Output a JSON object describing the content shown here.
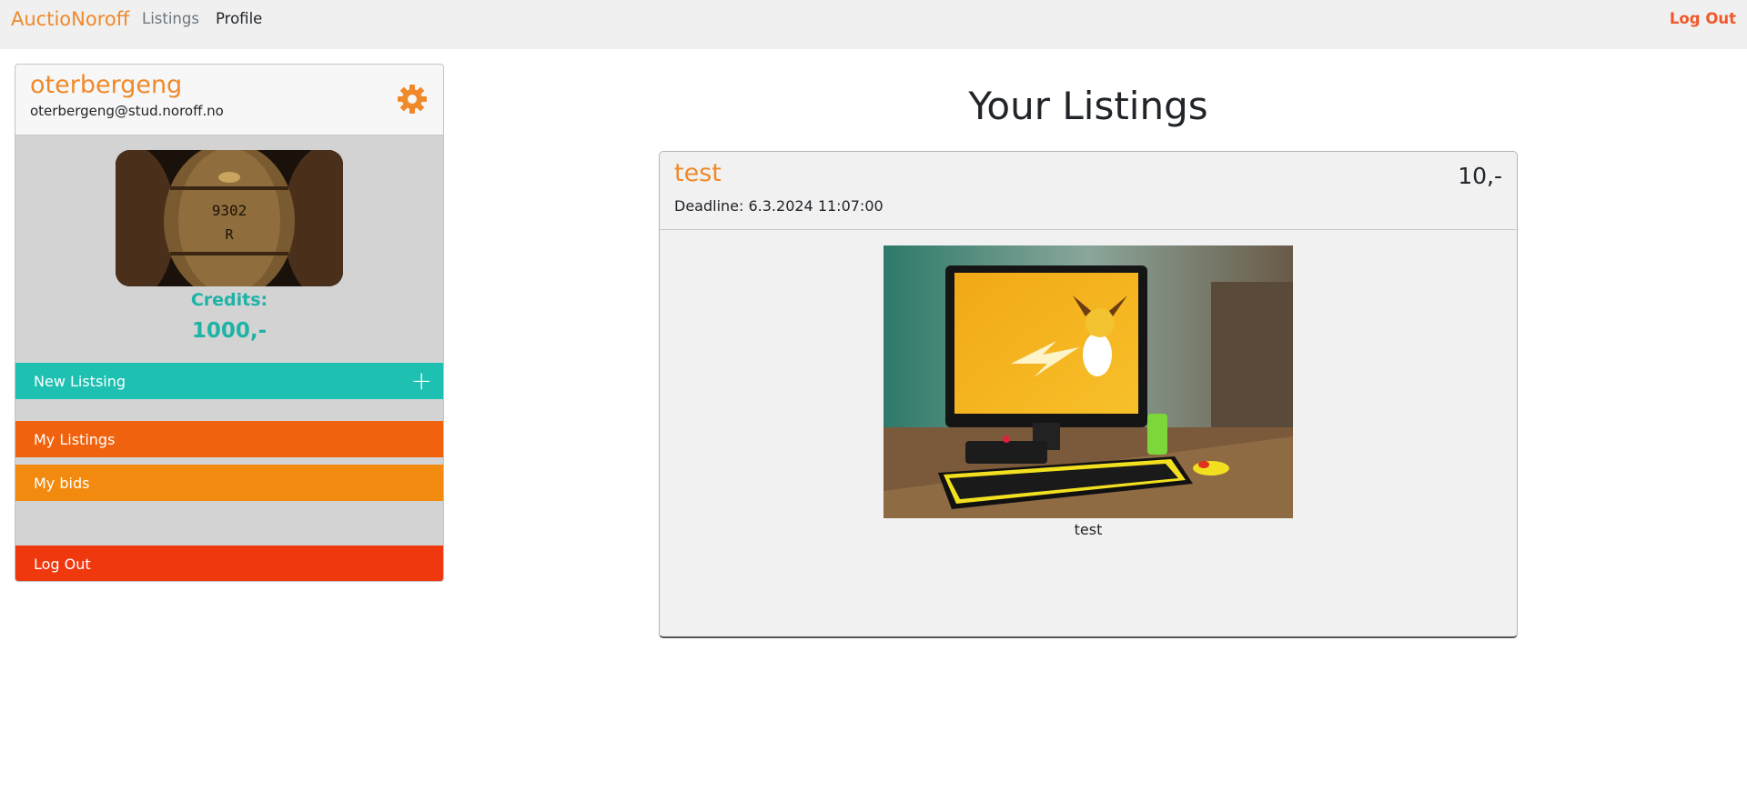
{
  "nav": {
    "brand": "AuctioNoroff",
    "links": [
      "Listings",
      "Profile"
    ],
    "logout": "Log Out"
  },
  "profile": {
    "username": "oterbergeng",
    "email": "oterbergeng@stud.noroff.no",
    "settings_icon": "gear-icon",
    "credits_label": "Credits:",
    "credits_value": "1000,-",
    "buttons": {
      "new_listing": "New Listsing",
      "new_listing_icon": "plus-icon",
      "my_listings": "My Listings",
      "my_bids": "My bids",
      "logout": "Log Out"
    }
  },
  "main": {
    "title": "Your Listings",
    "listings": [
      {
        "title": "test",
        "price": "10,-",
        "deadline": "Deadline: 6.3.2024 11:07:00",
        "caption": "test"
      }
    ]
  },
  "colors": {
    "accent_orange": "#f0892a",
    "teal": "#1ec0b1",
    "my_listings": "#f0620e",
    "my_bids": "#f28a10",
    "logout": "#f0380e",
    "nav_logout": "#f0582a"
  }
}
